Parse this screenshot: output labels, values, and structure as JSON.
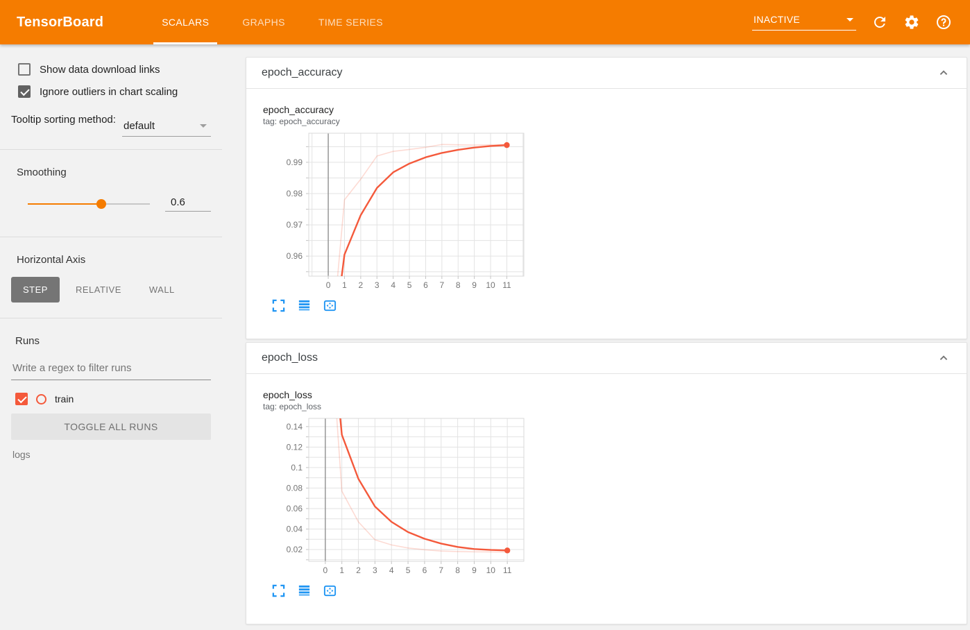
{
  "colors": {
    "header": "#f57c00",
    "run": "#f4593b",
    "icon_blue": "#2196f3",
    "checked_gray": "#616161"
  },
  "header": {
    "title": "TensorBoard",
    "tabs": [
      {
        "label": "SCALARS",
        "active": true
      },
      {
        "label": "GRAPHS",
        "active": false
      },
      {
        "label": "TIME SERIES",
        "active": false
      }
    ],
    "status": "INACTIVE",
    "icons": [
      "chevron-down-icon",
      "refresh-icon",
      "gear-icon",
      "help-icon"
    ]
  },
  "sidebar": {
    "show_download": {
      "label": "Show data download links",
      "checked": false
    },
    "ignore_outliers": {
      "label": "Ignore outliers in chart scaling",
      "checked": true
    },
    "tooltip_sorting": {
      "label": "Tooltip sorting method:",
      "value": "default"
    },
    "smoothing": {
      "label": "Smoothing",
      "value": "0.6",
      "percent": 60
    },
    "horizontal_axis": {
      "label": "Horizontal Axis",
      "options": [
        {
          "label": "STEP",
          "active": true
        },
        {
          "label": "RELATIVE",
          "active": false
        },
        {
          "label": "WALL",
          "active": false
        }
      ]
    },
    "runs": {
      "label": "Runs",
      "filter_placeholder": "Write a regex to filter runs",
      "items": [
        {
          "label": "train",
          "checked": true
        }
      ],
      "toggle_all_label": "TOGGLE ALL RUNS",
      "directory": "logs"
    }
  },
  "cards": [
    {
      "group": "epoch_accuracy"
    },
    {
      "group": "epoch_loss"
    }
  ],
  "chart_data": [
    {
      "type": "line",
      "title": "epoch_accuracy",
      "tag_line": "tag: epoch_accuracy",
      "x": [
        0,
        1,
        2,
        3,
        4,
        5,
        6,
        7,
        8,
        9,
        10,
        11
      ],
      "series": [
        {
          "name": "train (raw)",
          "style": "faint",
          "values": [
            0.92,
            0.978,
            0.9846,
            0.992,
            0.9935,
            0.9941,
            0.9948,
            0.9957,
            0.9956,
            0.9955,
            0.9956,
            0.9957
          ]
        },
        {
          "name": "train (smoothed 0.6)",
          "style": "solid",
          "end_dot": true,
          "values": [
            0.92,
            0.9605,
            0.9731,
            0.9818,
            0.9868,
            0.9896,
            0.9916,
            0.993,
            0.994,
            0.9947,
            0.9952,
            0.9955
          ]
        }
      ],
      "xlim": [
        -1.2,
        12.05
      ],
      "ylim": [
        0.9536,
        0.9993
      ],
      "ygrid_step": 0.005,
      "yticks_labeled": [
        0.96,
        0.97,
        0.98,
        0.99
      ],
      "xticks": [
        0,
        1,
        2,
        3,
        4,
        5,
        6,
        7,
        8,
        9,
        10,
        11
      ],
      "zero_line_x": 0,
      "grid": true,
      "legend": "none"
    },
    {
      "type": "line",
      "title": "epoch_loss",
      "tag_line": "tag: epoch_loss",
      "x": [
        0,
        1,
        2,
        3,
        4,
        5,
        6,
        7,
        8,
        9,
        10,
        11
      ],
      "series": [
        {
          "name": "train (raw)",
          "style": "faint",
          "values": [
            0.31,
            0.077,
            0.047,
            0.0295,
            0.0245,
            0.0215,
            0.0198,
            0.0185,
            0.018,
            0.0178,
            0.0177,
            0.0176
          ]
        },
        {
          "name": "train (smoothed 0.6)",
          "style": "solid",
          "end_dot": true,
          "values": [
            0.3,
            0.132,
            0.089,
            0.062,
            0.047,
            0.037,
            0.0305,
            0.0258,
            0.0225,
            0.0205,
            0.0196,
            0.0191
          ]
        }
      ],
      "xlim": [
        -1.0,
        12.0
      ],
      "ylim": [
        0.0085,
        0.148
      ],
      "ygrid_step": 0.01,
      "yticks_labeled": [
        0.02,
        0.04,
        0.06,
        0.08,
        0.1,
        0.12,
        0.14
      ],
      "xticks": [
        0,
        1,
        2,
        3,
        4,
        5,
        6,
        7,
        8,
        9,
        10,
        11
      ],
      "zero_line_x": 0,
      "grid": true,
      "legend": "none"
    }
  ]
}
